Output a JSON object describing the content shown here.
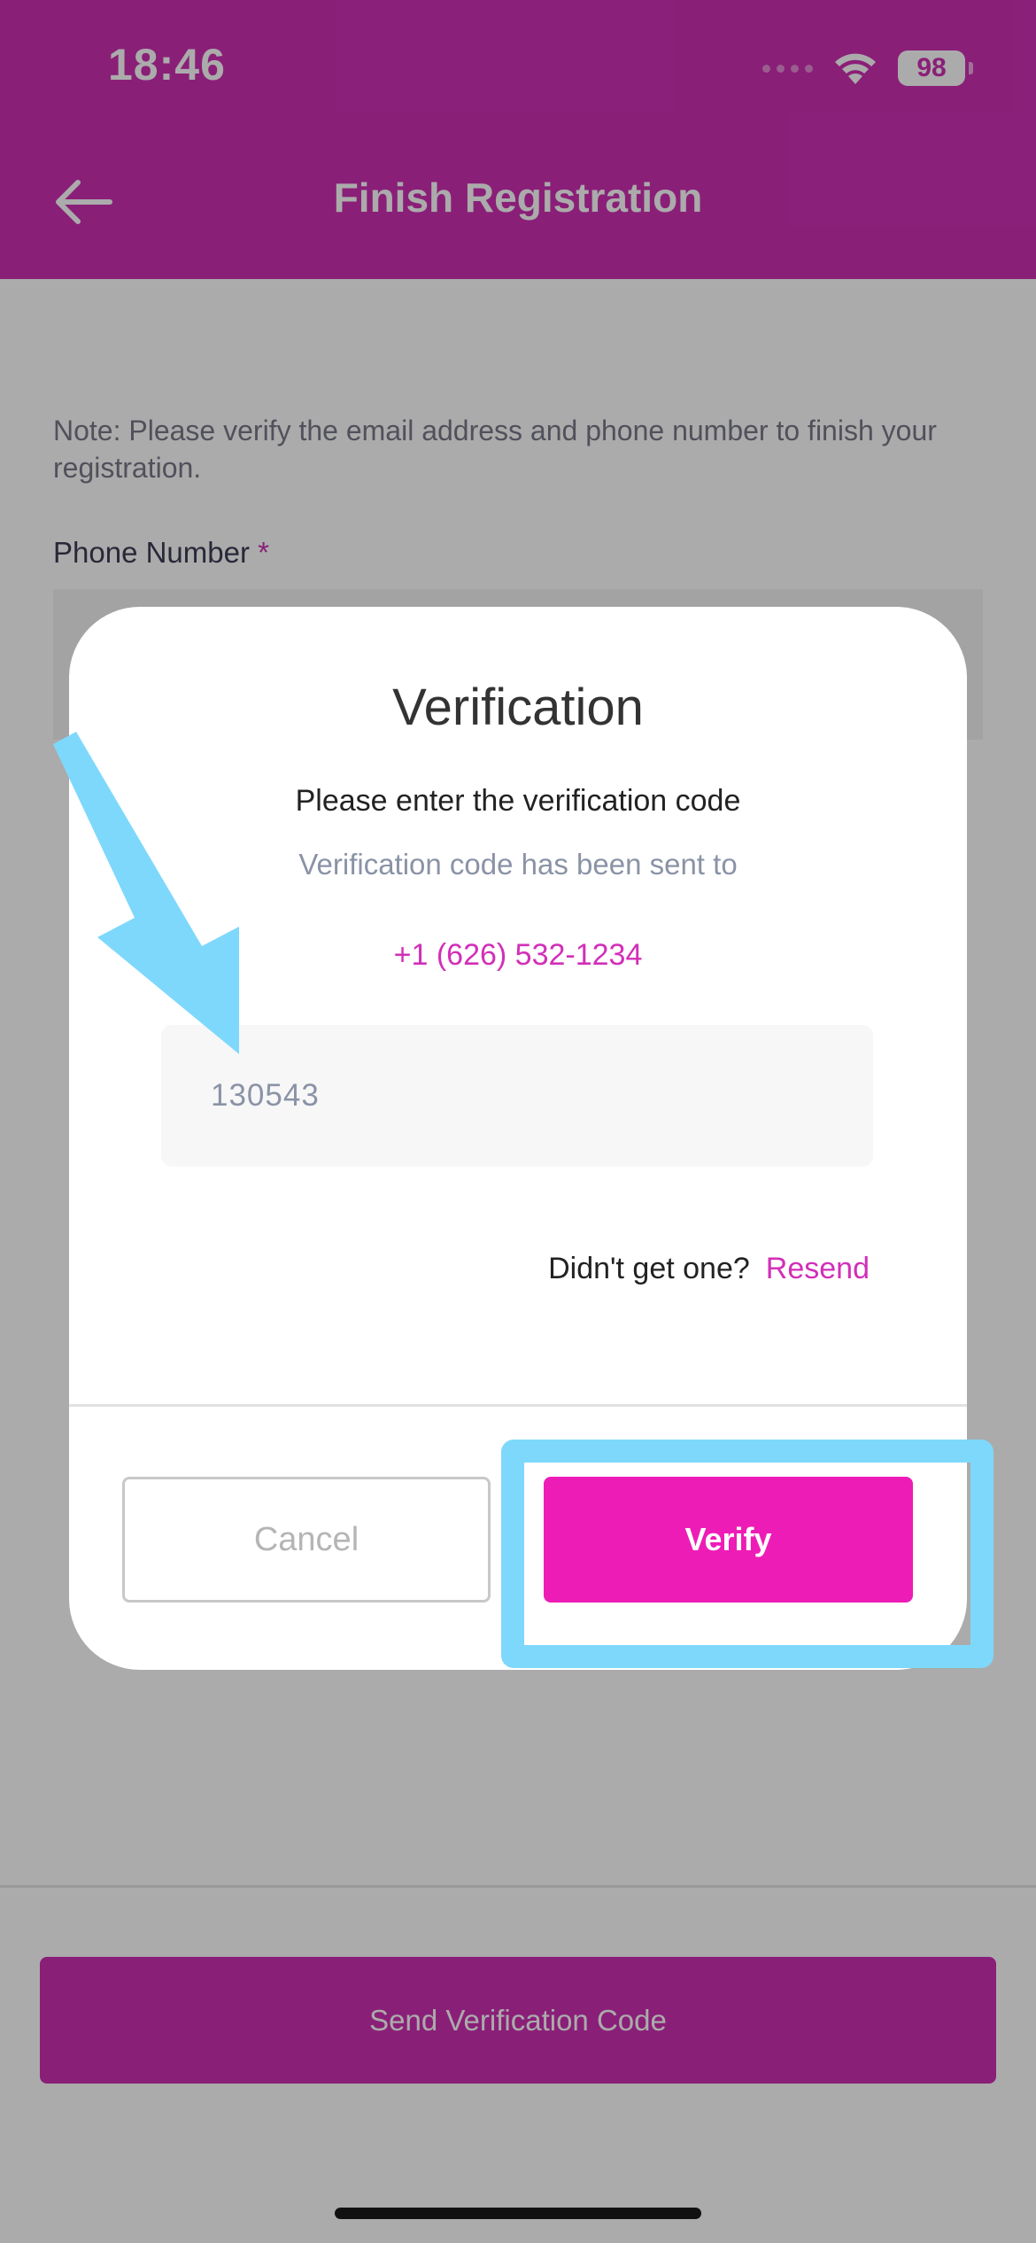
{
  "status_bar": {
    "time": "18:46",
    "battery_level": "98",
    "icons": [
      "cellular-signal-icon",
      "wifi-icon",
      "battery-icon"
    ]
  },
  "header": {
    "title": "Finish Registration",
    "back_icon": "back-arrow-icon"
  },
  "page": {
    "note": "Note: Please verify the email address and phone number to finish your registration.",
    "phone_label": "Phone Number",
    "required_mark": "*",
    "send_code_label": "Send Verification Code"
  },
  "modal": {
    "title": "Verification",
    "subtitle": "Please enter the verification code",
    "sent_to_text": "Verification code has been sent to",
    "phone_number": "+1 (626) 532-1234",
    "code_value": "130543",
    "resend_question": "Didn't get one?",
    "resend_label": "Resend",
    "cancel_label": "Cancel",
    "verify_label": "Verify"
  },
  "annotations": {
    "highlight_color": "#7ed8fc",
    "arrow_icon": "pointer-arrow-icon"
  },
  "colors": {
    "brand_magenta": "#ce2fb4",
    "verify_button": "#ee1cb6",
    "link_magenta": "#d22fb8",
    "muted_text": "#8a93a6"
  }
}
